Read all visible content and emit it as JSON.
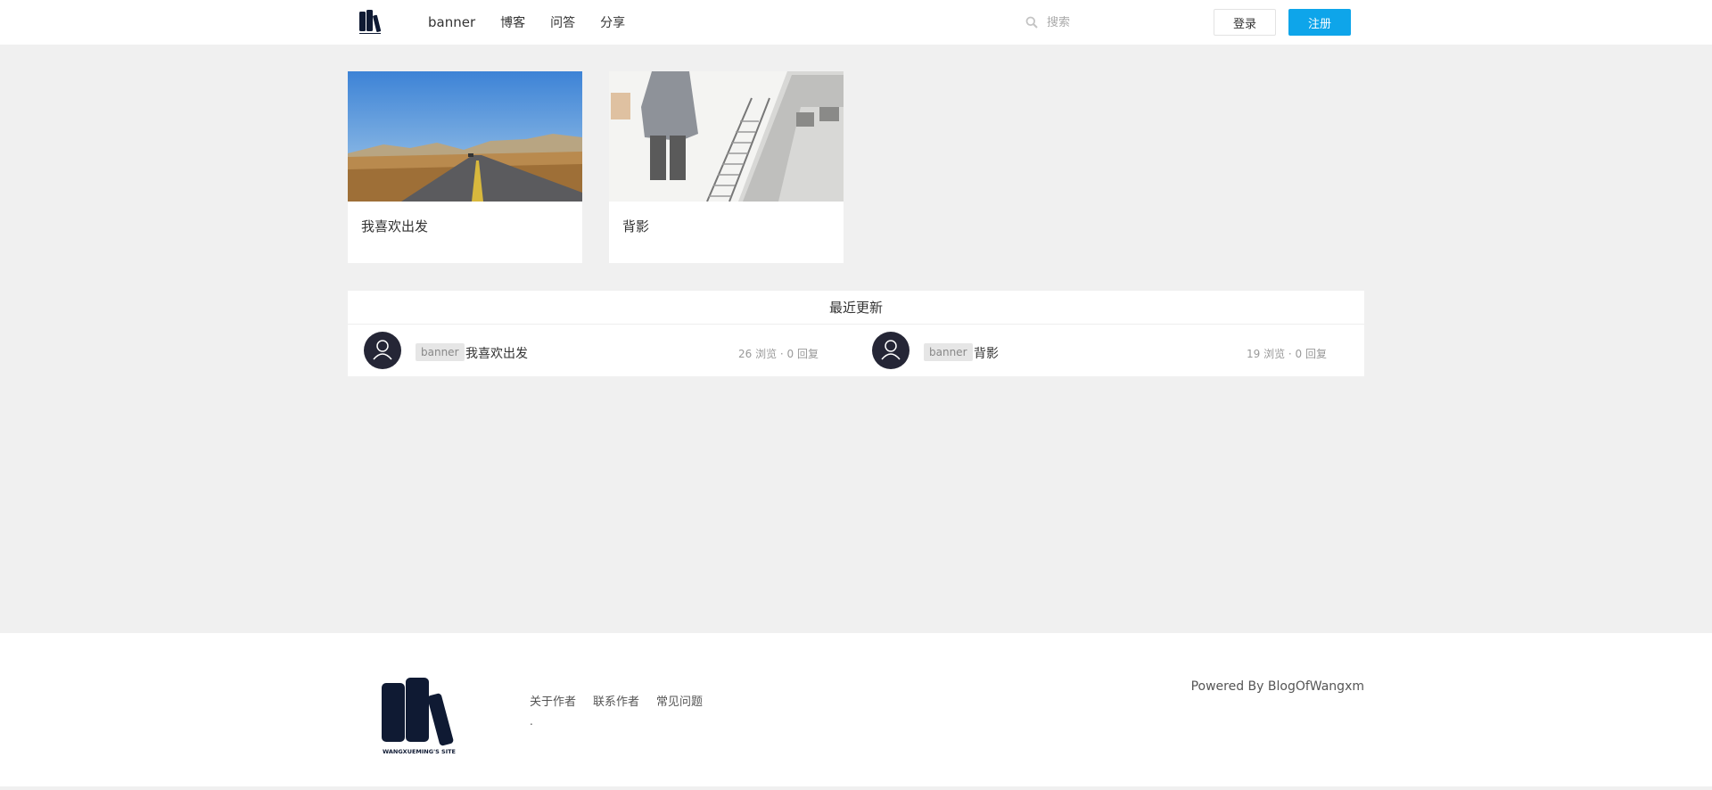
{
  "header": {
    "logo_icon": "books-logo-icon",
    "nav": [
      "banner",
      "博客",
      "问答",
      "分享"
    ],
    "search_placeholder": "搜索",
    "login_label": "登录",
    "register_label": "注册"
  },
  "cards": [
    {
      "title": "我喜欢出发",
      "image": "road-landscape"
    },
    {
      "title": "背影",
      "image": "railway-sketch"
    }
  ],
  "recent": {
    "heading": "最近更新",
    "items": [
      {
        "tag": "banner",
        "title": "我喜欢出发",
        "stats": "26 浏览 · 0 回复"
      },
      {
        "tag": "banner",
        "title": "背影",
        "stats": "19 浏览 · 0 回复"
      }
    ]
  },
  "footer": {
    "logo_text": "WANGXUEMING'S SITE",
    "links": [
      "关于作者",
      "联系作者",
      "常见问题"
    ],
    "dot": ".",
    "powered": "Powered By BlogOfWangxm"
  },
  "colors": {
    "accent": "#0ea5ea",
    "logo": "#0f1a33",
    "avatar": "#252636",
    "background": "#f0f0f0"
  }
}
